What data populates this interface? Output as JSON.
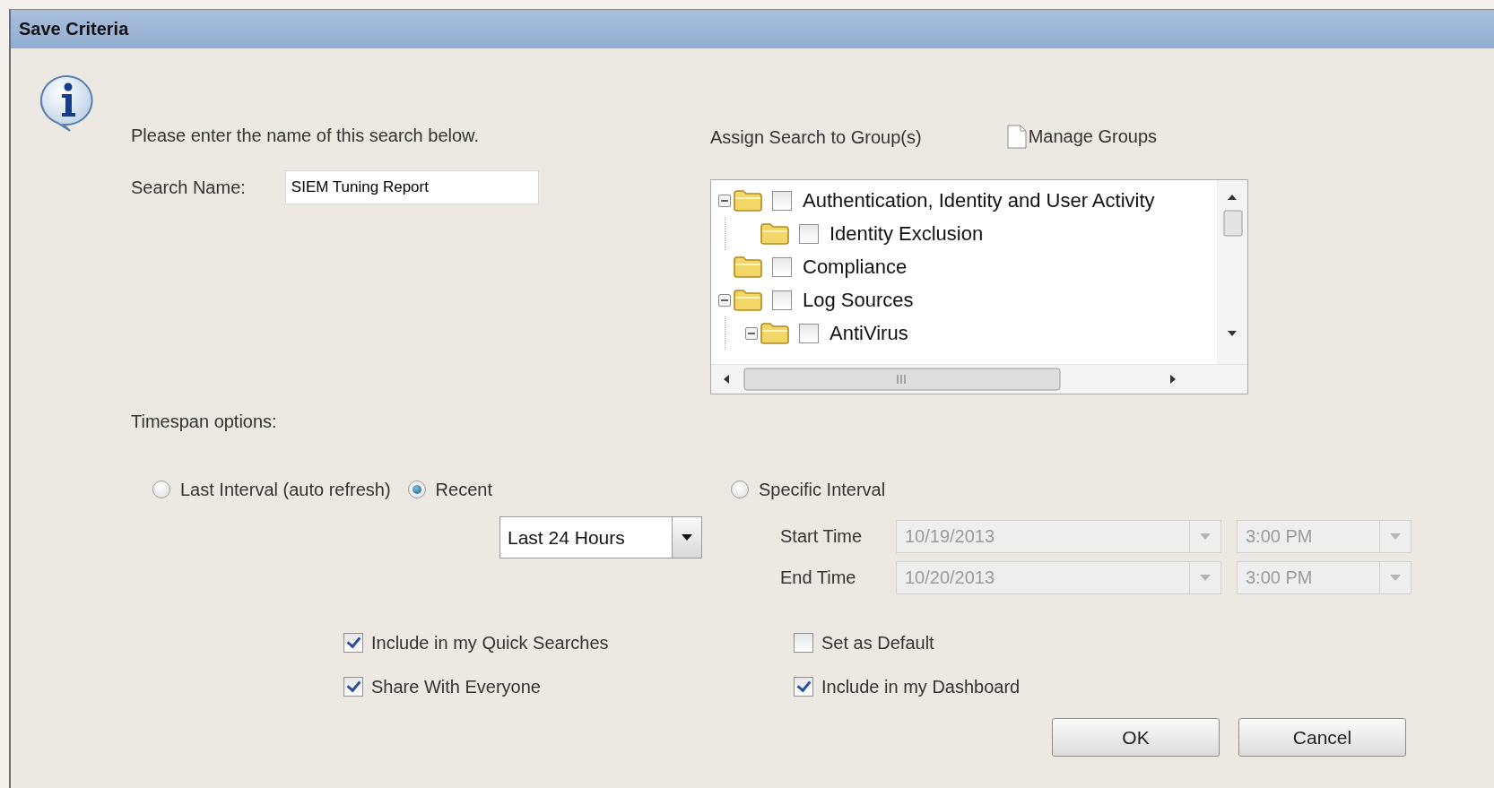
{
  "window": {
    "title": "Save Criteria"
  },
  "prompt": "Please enter the name of this search below.",
  "search_name": {
    "label": "Search Name:",
    "value": "SIEM Tuning Report"
  },
  "groups": {
    "label": "Assign Search to Group(s)",
    "manage_link": "Manage Groups",
    "tree": [
      {
        "label": "Authentication, Identity and User Activity",
        "checked": false,
        "expanded": true,
        "children": [
          {
            "label": "Identity Exclusion",
            "checked": false
          }
        ]
      },
      {
        "label": "Compliance",
        "checked": false
      },
      {
        "label": "Log Sources",
        "checked": false,
        "expanded": true,
        "children": [
          {
            "label": "AntiVirus",
            "checked": false,
            "expanded": true
          }
        ]
      }
    ]
  },
  "timespan": {
    "label": "Timespan options:",
    "options": [
      {
        "label": "Last Interval (auto refresh)",
        "selected": false
      },
      {
        "label": "Recent",
        "selected": true
      },
      {
        "label": "Specific Interval",
        "selected": false
      }
    ],
    "recent_range": {
      "value": "Last 24 Hours"
    },
    "start": {
      "label": "Start Time",
      "date": "10/19/2013",
      "time": "3:00 PM",
      "disabled": true
    },
    "end": {
      "label": "End Time",
      "date": "10/20/2013",
      "time": "3:00 PM",
      "disabled": true
    }
  },
  "options": [
    {
      "label": "Include in my Quick Searches",
      "checked": true
    },
    {
      "label": "Set as Default",
      "checked": false
    },
    {
      "label": "Share With Everyone",
      "checked": true
    },
    {
      "label": "Include in my Dashboard",
      "checked": true
    }
  ],
  "buttons": [
    {
      "label": "OK"
    },
    {
      "label": "Cancel"
    }
  ]
}
